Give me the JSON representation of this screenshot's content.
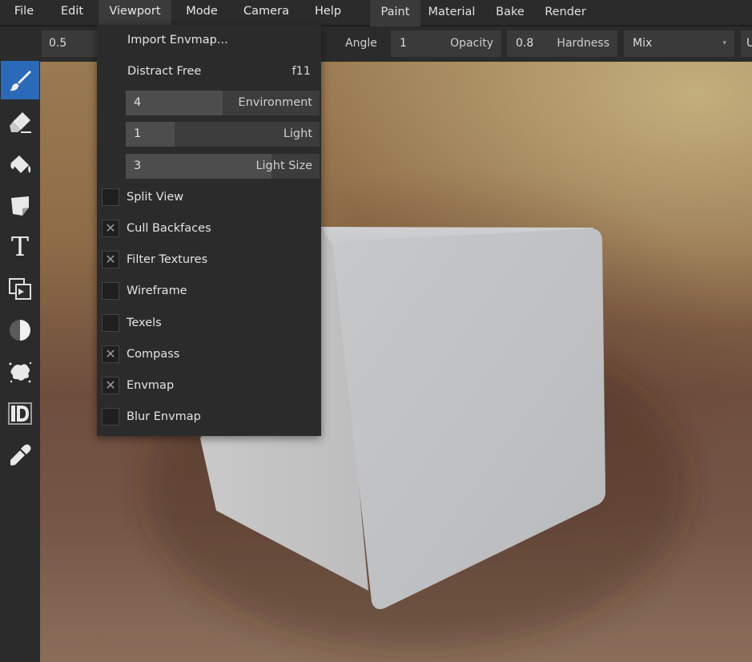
{
  "menubar": {
    "items": [
      "File",
      "Edit",
      "Viewport",
      "Mode",
      "Camera",
      "Help"
    ],
    "workspace_tabs": [
      "Paint",
      "Material",
      "Bake",
      "Render"
    ]
  },
  "header": {
    "radius_value": "0.5",
    "angle_label": "Angle",
    "opacity_value": "1",
    "opacity_label": "Opacity",
    "hardness_value": "0.8",
    "hardness_label": "Hardness",
    "blend_value": "Mix",
    "trailing_letter": "U"
  },
  "viewport_menu": {
    "import_envmap": "Import Envmap...",
    "distract_free": "Distract Free",
    "distract_free_shortcut": "f11",
    "sliders": [
      {
        "value": "4",
        "label": "Environment",
        "fill": 0.5
      },
      {
        "value": "1",
        "label": "Light",
        "fill": 0.25
      },
      {
        "value": "3",
        "label": "Light Size",
        "fill": 0.75
      }
    ],
    "checks": [
      {
        "label": "Split View",
        "checked": false
      },
      {
        "label": "Cull Backfaces",
        "checked": true
      },
      {
        "label": "Filter Textures",
        "checked": true
      },
      {
        "label": "Wireframe",
        "checked": false
      },
      {
        "label": "Texels",
        "checked": false
      },
      {
        "label": "Compass",
        "checked": true
      },
      {
        "label": "Envmap",
        "checked": true
      },
      {
        "label": "Blur Envmap",
        "checked": false
      }
    ],
    "check_mark": "✕"
  },
  "toolbar": {
    "tools": [
      "brush-icon",
      "eraser-icon",
      "fill-icon",
      "decal-icon",
      "text-icon",
      "clone-icon",
      "blur-icon",
      "particle-icon",
      "bake-icon",
      "picker-icon"
    ],
    "text_tool_glyph": "T",
    "active_color": "#2a6ab8"
  },
  "colors": {
    "panel": "#2b2b2b",
    "accent": "#2a6ab8"
  }
}
